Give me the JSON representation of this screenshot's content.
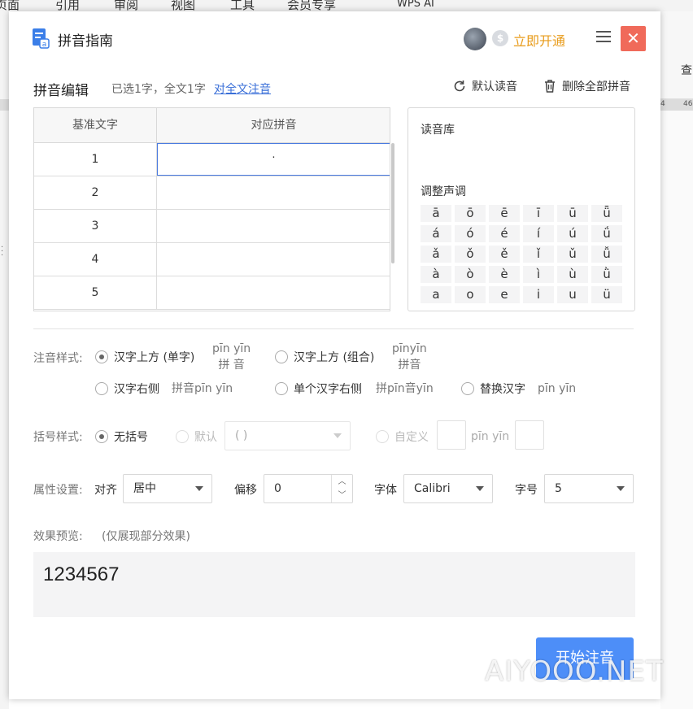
{
  "background": {
    "menu": [
      "页面",
      "引用",
      "审阅",
      "视图",
      "工具",
      "会员专享",
      "WPS AI"
    ],
    "ribbon_label": "查",
    "ruler": [
      "4",
      "46"
    ]
  },
  "dialog": {
    "title": "拼音指南",
    "vip_link": "立即开通",
    "close_glyph": "✕"
  },
  "editor": {
    "title": "拼音编辑",
    "selection_info": "已选1字，全文1字",
    "full_text_link": "对全文注音",
    "default_reading": "默认读音",
    "delete_all": "删除全部拼音"
  },
  "table": {
    "headers": [
      "基准文字",
      "对应拼音"
    ],
    "rows": [
      {
        "base": "1",
        "pinyin": "·"
      },
      {
        "base": "2",
        "pinyin": ""
      },
      {
        "base": "3",
        "pinyin": ""
      },
      {
        "base": "4",
        "pinyin": ""
      },
      {
        "base": "5",
        "pinyin": ""
      }
    ]
  },
  "library": {
    "title": "读音库",
    "tone_title": "调整声调",
    "tones": [
      [
        "ā",
        "ō",
        "ē",
        "ī",
        "ū",
        "ǖ"
      ],
      [
        "á",
        "ó",
        "é",
        "í",
        "ú",
        "ǘ"
      ],
      [
        "ǎ",
        "ǒ",
        "ě",
        "ǐ",
        "ǔ",
        "ǚ"
      ],
      [
        "à",
        "ò",
        "è",
        "ì",
        "ù",
        "ǜ"
      ],
      [
        "a",
        "o",
        "e",
        "i",
        "u",
        "ü"
      ]
    ]
  },
  "style": {
    "label": "注音样式:",
    "options": [
      {
        "label": "汉字上方 (单字)",
        "sample_top": "pīn yīn",
        "sample_bottom": "拼  音",
        "selected": true
      },
      {
        "label": "汉字上方 (组合)",
        "sample_top": "pīnyīn",
        "sample_bottom": "拼音",
        "selected": false
      },
      {
        "label": "汉字右侧",
        "sample": "拼音pīn yīn",
        "selected": false
      },
      {
        "label": "单个汉字右侧",
        "sample": "拼pīn音yīn",
        "selected": false
      },
      {
        "label": "替换汉字",
        "sample": "pīn yīn",
        "selected": false
      }
    ]
  },
  "bracket": {
    "label": "括号样式:",
    "none": "无括号",
    "default": "默认",
    "default_value": "( )",
    "custom": "自定义",
    "custom_sample": "pīn yīn"
  },
  "attrs": {
    "label": "属性设置:",
    "align_label": "对齐",
    "align_value": "居中",
    "offset_label": "偏移",
    "offset_value": "0",
    "font_label": "字体",
    "font_value": "Calibri",
    "size_label": "字号",
    "size_value": "5"
  },
  "preview": {
    "label": "效果预览:",
    "note": "(仅展现部分效果)",
    "text": "1234567"
  },
  "start_button": "开始注音",
  "watermark": "AIYOOO.NET"
}
